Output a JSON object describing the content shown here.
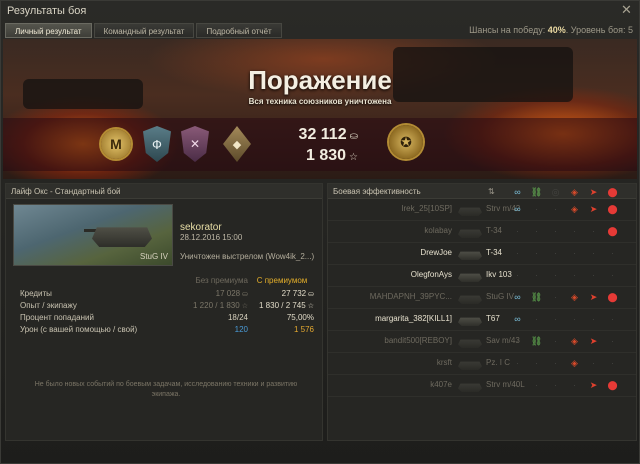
{
  "window": {
    "title": "Результаты боя",
    "close": "✕"
  },
  "tabs": [
    "Личный результат",
    "Командный результат",
    "Подробный отчёт"
  ],
  "chance": {
    "prefix": "Шансы на победу: ",
    "value": "40%",
    "suffix": ". Уровень боя: 5"
  },
  "banner": {
    "title": "Поражение",
    "subtitle": "Вся техника союзников уничтожена",
    "credits": "32 112",
    "xp": "1 830",
    "credits_icon": "coin-icon",
    "xp_icon": "star-icon"
  },
  "medals": [
    {
      "name": "mastery-badge",
      "glyph": "M"
    },
    {
      "name": "shield-medal",
      "glyph": "Ф"
    },
    {
      "name": "crossed-swords-medal",
      "glyph": "✕"
    },
    {
      "name": "diamond-medal",
      "glyph": "◆"
    }
  ],
  "emblem_glyph": "✪",
  "left": {
    "header": "Лайф Окс - Стандартный бой",
    "player": "sekorator",
    "date": "28.12.2016 15:00",
    "vehicle": "StuG IV",
    "killed_by": "Уничтожен выстрелом (Wow4ik_2...)",
    "col_base": "Без премиума",
    "col_prem": "С премиумом",
    "rows": [
      {
        "label": "Кредиты",
        "base": "17 028",
        "prem": "27 732",
        "icon": "⛀"
      },
      {
        "label": "Опыт / экипажу",
        "base": "1 220 / 1 830",
        "prem": "1 830 / 2 745",
        "icon": "☆"
      },
      {
        "label": "Процент попаданий",
        "base": "18/24",
        "prem": "75,00%",
        "icon": ""
      },
      {
        "label": "Урон (с вашей помощью / свой)",
        "base": "120",
        "prem": "1 576",
        "icon": ""
      }
    ],
    "no_events": "Не было новых событий по боевым задачам, исследованию техники и развитию экипажа."
  },
  "right": {
    "header": "Боевая эффективность",
    "sort_glyph": "⇅",
    "rows": [
      {
        "player": "Irek_25[10SP]",
        "tank": "Strv m/42",
        "alive": false,
        "icons": [
          "spot",
          "off",
          "off",
          "crit",
          "dmg",
          "kill"
        ]
      },
      {
        "player": "kolabay",
        "tank": "T-34",
        "alive": false,
        "icons": [
          "off",
          "off",
          "off",
          "off",
          "off",
          "kill"
        ]
      },
      {
        "player": "DrewJoe",
        "tank": "T-34",
        "alive": true,
        "icons": [
          "off",
          "off",
          "off",
          "off",
          "off",
          "off"
        ]
      },
      {
        "player": "OlegfonAys",
        "tank": "Ikv 103",
        "alive": true,
        "icons": [
          "off",
          "off",
          "off",
          "off",
          "off",
          "off"
        ]
      },
      {
        "player": "MAHDAPNH_39PYC...",
        "tank": "StuG IV",
        "alive": false,
        "icons": [
          "spot",
          "track",
          "off",
          "crit",
          "dmg",
          "kill"
        ]
      },
      {
        "player": "margarita_382[KILL1]",
        "tank": "T67",
        "alive": true,
        "icons": [
          "spot",
          "off",
          "off",
          "off",
          "off",
          "off"
        ]
      },
      {
        "player": "bandit500[REBOY]",
        "tank": "Sav m/43",
        "alive": false,
        "icons": [
          "off",
          "track",
          "off",
          "crit",
          "dmg",
          "off"
        ]
      },
      {
        "player": "krsft",
        "tank": "Pz. I C",
        "alive": false,
        "icons": [
          "off",
          "off",
          "off",
          "crit",
          "off",
          "off"
        ]
      },
      {
        "player": "k407e",
        "tank": "Strv m/40L",
        "alive": false,
        "icons": [
          "off",
          "off",
          "off",
          "off",
          "dmg",
          "kill"
        ]
      }
    ]
  }
}
